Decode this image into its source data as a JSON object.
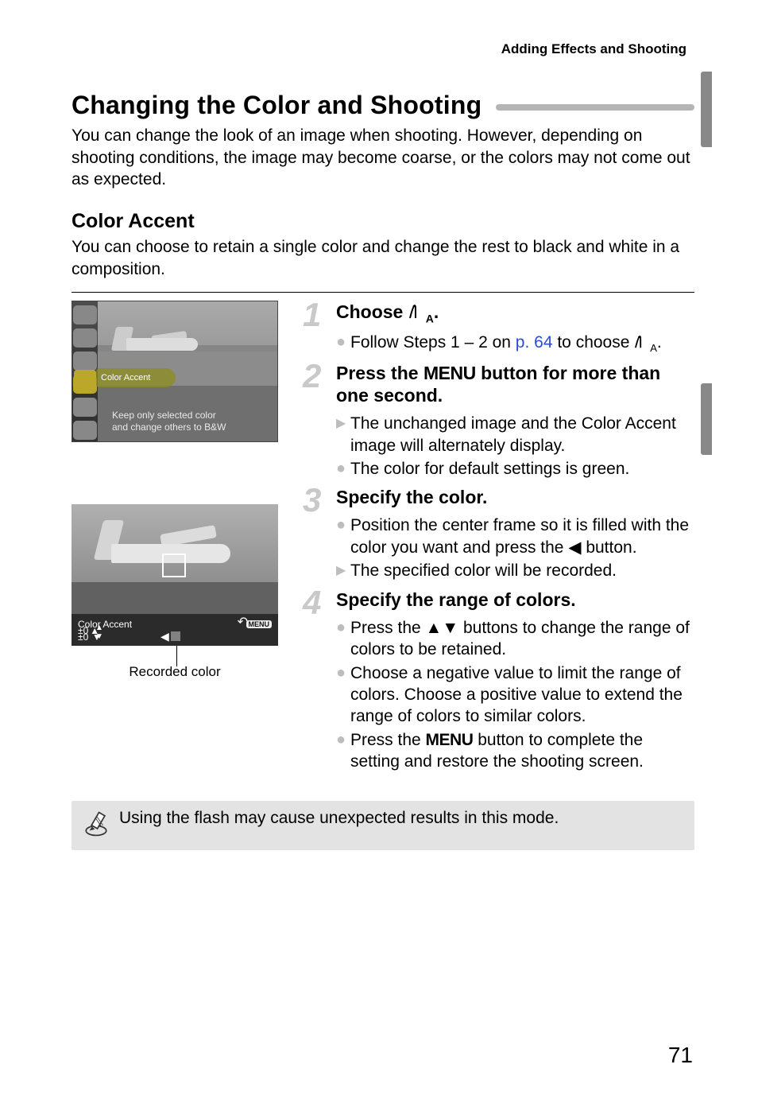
{
  "header": {
    "breadcrumb": "Adding Effects and Shooting"
  },
  "h1": "Changing the Color and Shooting",
  "intro": "You can change the look of an image when shooting. However, depending on shooting conditions, the image may become coarse, or the colors may not come out as expected.",
  "h2": "Color Accent",
  "sub_intro": "You can choose to retain a single color and change the rest to black and white in a composition.",
  "fig1": {
    "menu_highlight": "Color Accent",
    "tip_line1": "Keep only selected color",
    "tip_line2": "and change others to B&W"
  },
  "fig2": {
    "label": "Color Accent",
    "pm": "±0",
    "menu_word": "MENU"
  },
  "recorded_caption": "Recorded color",
  "glyphs": {
    "mode_T": "T",
    "mode_A": "A",
    "menu_word": "MENU",
    "left": "◀",
    "up": "▲",
    "down": "▼"
  },
  "steps": {
    "s1": {
      "num": "1",
      "head_a": "Choose ",
      "head_b": ".",
      "b1a": "Follow Steps 1 – 2 on ",
      "b1link": "p. 64",
      "b1b": " to choose ",
      "b1c": "."
    },
    "s2": {
      "num": "2",
      "head_a": "Press the ",
      "head_b": " button for more than one second.",
      "b1": "The unchanged image and the Color Accent image will alternately display.",
      "b2": "The color for default settings is green."
    },
    "s3": {
      "num": "3",
      "head": "Specify the color.",
      "b1a": "Position the center frame so it is filled with the color you want and press the ",
      "b1b": " button.",
      "b2": "The specified color will be recorded."
    },
    "s4": {
      "num": "4",
      "head": "Specify the range of colors.",
      "b1a": "Press the ",
      "b1b": " buttons to change the range of colors to be retained.",
      "b2": "Choose a negative value to limit the range of colors. Choose a positive value to extend the range of colors to similar colors.",
      "b3a": "Press the ",
      "b3b": " button to complete the setting and restore the shooting screen."
    }
  },
  "note": "Using the flash may cause unexpected results in this mode.",
  "page_number": "71"
}
